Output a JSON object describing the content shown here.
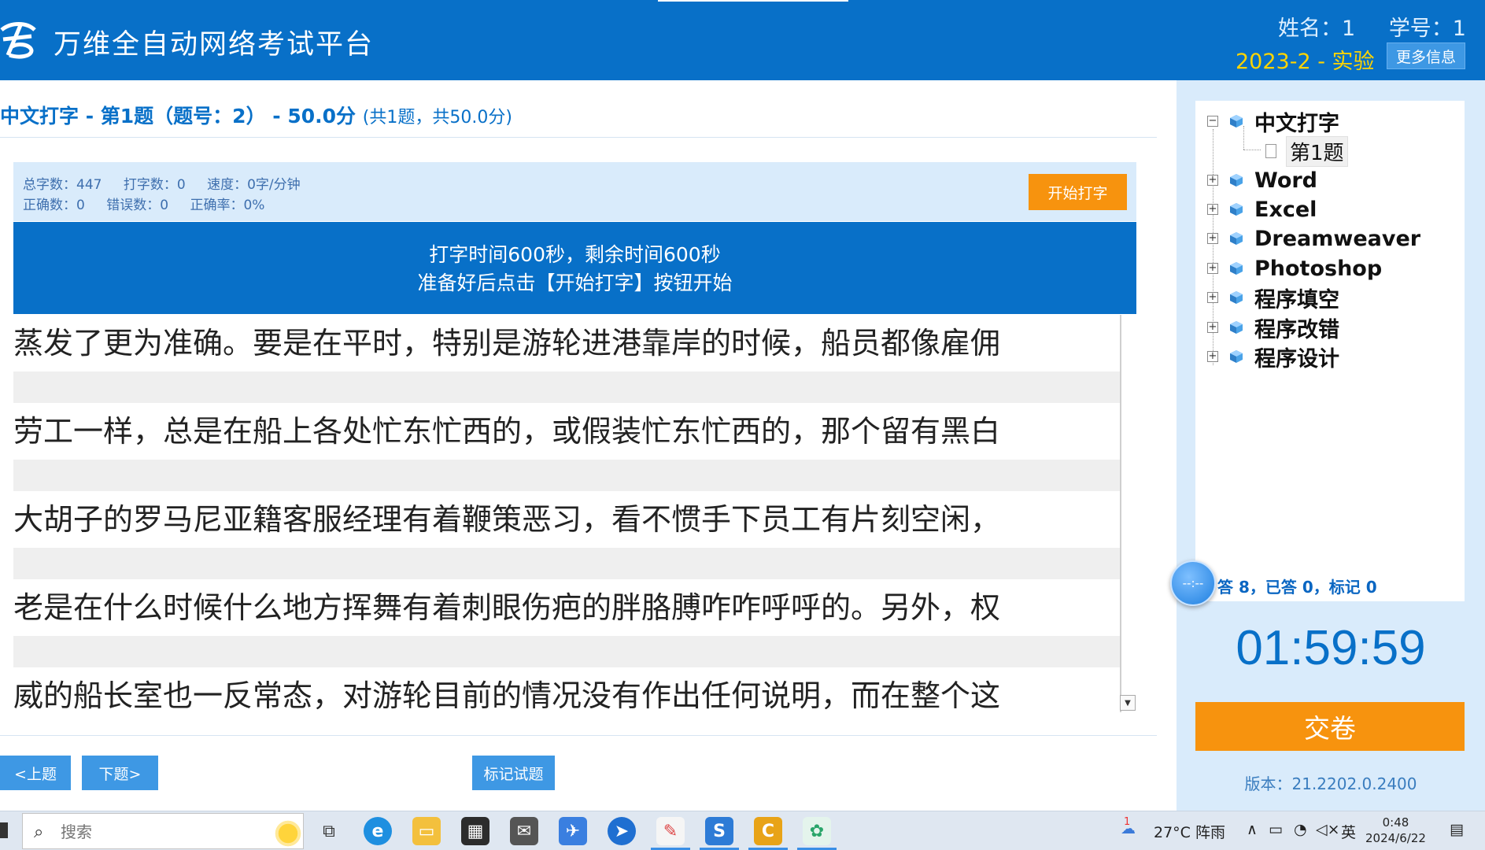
{
  "header": {
    "app_title": "万维全自动网络考试平台",
    "name_label": "姓名：1",
    "student_id_label": "学号：1",
    "exam_name": "2023-2 - 实验",
    "more_info_button": "更多信息",
    "colors": {
      "bar": "#0870c8",
      "exam_name": "#ffd400"
    }
  },
  "question": {
    "title": "中文打字 - 第1题（题号：2） - 50.0分",
    "subtitle": "(共1题，共50.0分)"
  },
  "stats": {
    "total_chars": "总字数：447",
    "typed_chars": "打字数：0",
    "speed": "速度：0字/分钟",
    "correct": "正确数：0",
    "wrong": "错误数：0",
    "accuracy": "正确率：0%"
  },
  "start_button": "开始打字",
  "banner": {
    "line1": "打字时间600秒，剩余时间600秒",
    "line2": "准备好后点击【开始打字】按钮开始"
  },
  "text_lines": [
    "蒸发了更为准确。要是在平时，特别是游轮进港靠岸的时候，船员都像雇佣",
    "劳工一样，总是在船上各处忙东忙西的，或假装忙东忙西的，那个留有黑白",
    "大胡子的罗马尼亚籍客服经理有着鞭策恶习，看不惯手下员工有片刻空闲，",
    "老是在什么时候什么地方挥舞有着刺眼伤疤的胖胳膊咋咋呼呼的。另外，权",
    "威的船长室也一反常态，对游轮目前的情况没有作出任何说明，而在整个这"
  ],
  "nav": {
    "prev": "<上题",
    "next": "下题>",
    "mark": "标记试题"
  },
  "tree": {
    "items": [
      "中文打字",
      "Word",
      "Excel",
      "Dreamweaver",
      "Photoshop",
      "程序填空",
      "程序改错",
      "程序设计"
    ],
    "child": "第1题",
    "expanded_symbol": "−",
    "collapsed_symbol": "+"
  },
  "progress": {
    "circle_text": "--:--",
    "summary": "答 8，已答 0，标记 0"
  },
  "timer": "01:59:59",
  "submit_button": "交卷",
  "version": "版本：21.2202.0.2400",
  "taskbar": {
    "search_placeholder": "搜索",
    "weather": "27°C  阵雨",
    "ime": "英",
    "time": "0:48",
    "date": "2024/6/22",
    "weather_badge": "1",
    "icons": [
      "task-view-icon",
      "edge-icon",
      "file-explorer-icon",
      "store-icon",
      "mail-icon",
      "feishu-icon",
      "browser-icon",
      "notes-icon",
      "wps-icon",
      "c-app-icon",
      "exam-app-icon"
    ]
  }
}
